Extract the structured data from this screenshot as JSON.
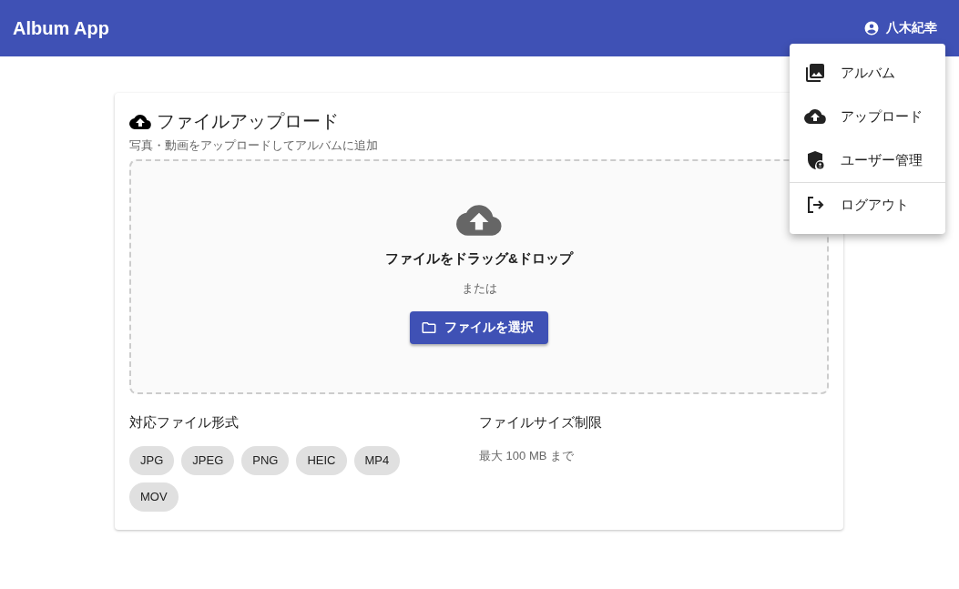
{
  "app_bar": {
    "title": "Album App",
    "user": "八木紀幸"
  },
  "menu": {
    "items": [
      {
        "label": "アルバム",
        "divider_before": false
      },
      {
        "label": "アップロード",
        "divider_before": false
      },
      {
        "label": "ユーザー管理",
        "divider_before": false
      },
      {
        "label": "ログアウト",
        "divider_before": true
      }
    ]
  },
  "card": {
    "title": "ファイルアップロード",
    "subtitle": "写真・動画をアップロードしてアルバムに追加",
    "dropzone": {
      "heading": "ファイルをドラッグ&ドロップ",
      "or": "または",
      "button": "ファイルを選択"
    },
    "formats": {
      "heading": "対応ファイル形式",
      "chips": [
        "JPG",
        "JPEG",
        "PNG",
        "HEIC",
        "MP4",
        "MOV"
      ]
    },
    "size_limit": {
      "heading": "ファイルサイズ制限",
      "text": "最大 100 MB まで"
    }
  }
}
